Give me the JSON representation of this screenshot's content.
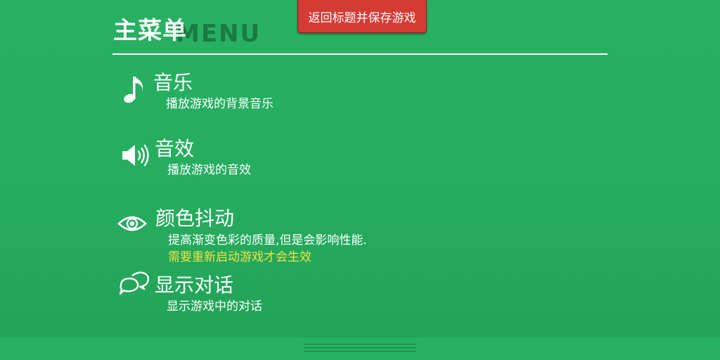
{
  "header": {
    "title": "主菜单",
    "watermark": "MENU",
    "return_button": "返回标题并保存游戏"
  },
  "options": [
    {
      "icon": "music-note-icon",
      "title": "音乐",
      "description": "播放游戏的背景音乐"
    },
    {
      "icon": "speaker-icon",
      "title": "音效",
      "description": "播放游戏的音效"
    },
    {
      "icon": "eye-icon",
      "title": "颜色抖动",
      "description": "提高渐变色彩的质量,但是会影响性能.",
      "warning": "需要重新启动游戏才会生效"
    },
    {
      "icon": "chat-bubbles-icon",
      "title": "显示对话",
      "description": "显示游戏中的对话"
    }
  ],
  "colors": {
    "background": "#27b062",
    "return_button": "#d43b35",
    "warning_text": "#f1e345",
    "watermark": "#1a7a40"
  }
}
